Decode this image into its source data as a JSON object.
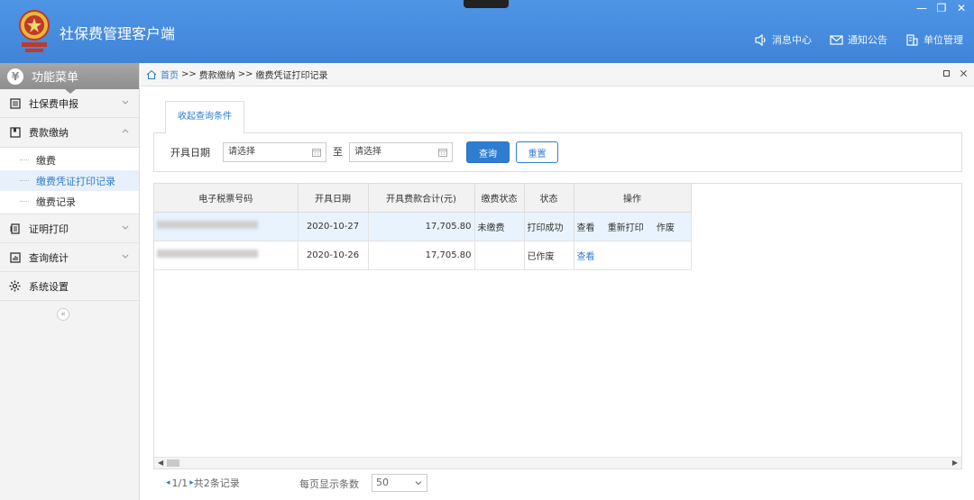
{
  "app": {
    "title": "社保费管理客户端",
    "window_controls": {
      "minimize": "—",
      "restore": "❐",
      "close": "✕"
    }
  },
  "top_links": [
    {
      "label": "消息中心",
      "icon": "speaker-icon"
    },
    {
      "label": "通知公告",
      "icon": "mail-icon"
    },
    {
      "label": "单位管理",
      "icon": "building-icon"
    }
  ],
  "sidebar": {
    "header": "功能菜单",
    "header_icon": "yen-icon",
    "items": [
      {
        "label": "社保费申报",
        "icon": "list-icon",
        "expanded": false
      },
      {
        "label": "费款缴纳",
        "icon": "bookmark-icon",
        "expanded": true,
        "children": [
          {
            "label": "缴费",
            "active": false
          },
          {
            "label": "缴费凭证打印记录",
            "active": true
          },
          {
            "label": "缴费记录",
            "active": false
          }
        ]
      },
      {
        "label": "证明打印",
        "icon": "document-icon",
        "expanded": false
      },
      {
        "label": "查询统计",
        "icon": "chart-icon",
        "expanded": false
      },
      {
        "label": "系统设置",
        "icon": "gear-icon",
        "expanded": false
      }
    ],
    "collapse_label": "«"
  },
  "breadcrumb": {
    "home": "首页",
    "separator": ">>",
    "items": [
      "费款缴纳",
      "缴费凭证打印记录"
    ]
  },
  "query": {
    "tab_label": "收起查询条件",
    "date_label": "开具日期",
    "to_label": "至",
    "start_placeholder": "请选择",
    "end_placeholder": "请选择",
    "search_button": "查询",
    "reset_button": "重置"
  },
  "table": {
    "columns": [
      "电子税票号码",
      "开具日期",
      "开具费款合计(元)",
      "缴费状态",
      "状态",
      "操作"
    ],
    "rows": [
      {
        "ticket_no": "",
        "date": "2020-10-27",
        "amount": "17,705.80",
        "pay_status": "未缴费",
        "status": "打印成功",
        "actions": [
          {
            "label": "查看",
            "link": false
          },
          {
            "label": "重新打印",
            "link": false
          },
          {
            "label": "作废",
            "link": false
          }
        ],
        "selected": true
      },
      {
        "ticket_no": "",
        "date": "2020-10-26",
        "amount": "17,705.80",
        "pay_status": "",
        "status": "已作废",
        "actions": [
          {
            "label": "查看",
            "link": true
          }
        ],
        "selected": false
      }
    ]
  },
  "pager": {
    "prev": "◂",
    "page": "1/1",
    "next": "▸",
    "total": "共2条记录",
    "per_page_label": "每页显示条数",
    "per_page_value": "50"
  },
  "colors": {
    "header_blue": "#4a90e2",
    "accent": "#2e7dd1",
    "selected_row": "#e9f3fd"
  }
}
